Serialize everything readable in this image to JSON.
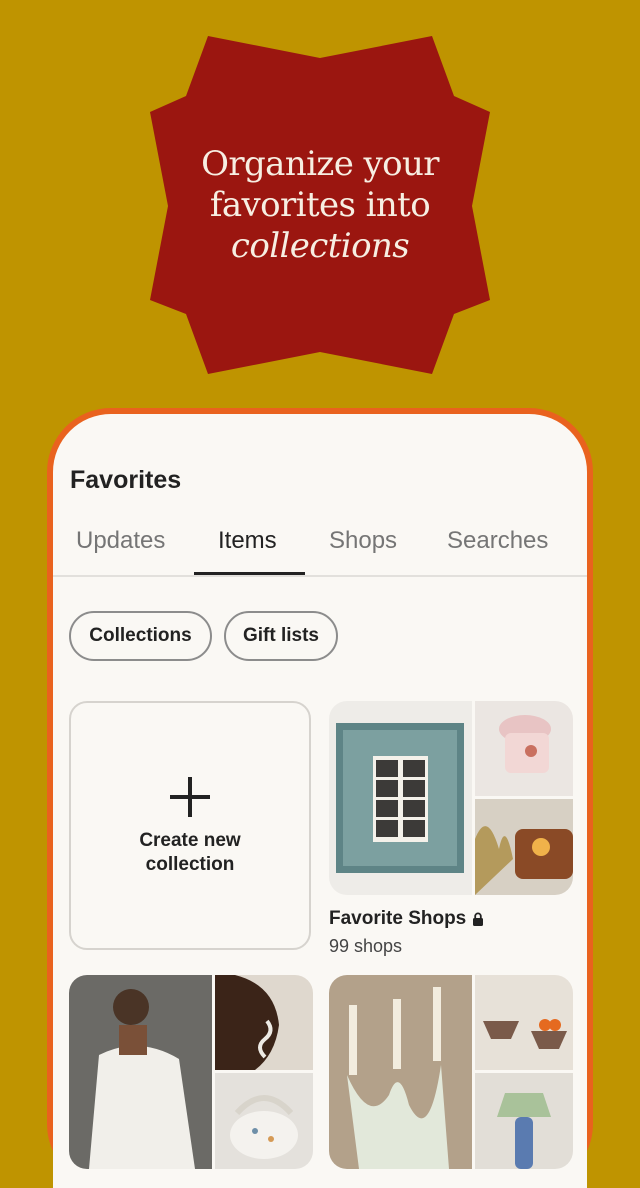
{
  "headline": {
    "line1": "Organize your",
    "line2": "favorites into",
    "line3": "collections"
  },
  "colors": {
    "background": "#BF9400",
    "badge": "#9B1610",
    "phone_frame": "#E9621E",
    "screen": "#FAF8F4"
  },
  "favorites": {
    "title": "Favorites",
    "tabs": [
      {
        "label": "Updates"
      },
      {
        "label": "Items"
      },
      {
        "label": "Shops"
      },
      {
        "label": "Searches"
      }
    ],
    "active_tab": "Items",
    "chips": [
      {
        "label": "Collections"
      },
      {
        "label": "Gift lists"
      }
    ],
    "create_label": "Create new collection",
    "collections": [
      {
        "name": "Favorite Shops",
        "count": "99 shops",
        "private_icon": "lock-icon"
      }
    ]
  }
}
